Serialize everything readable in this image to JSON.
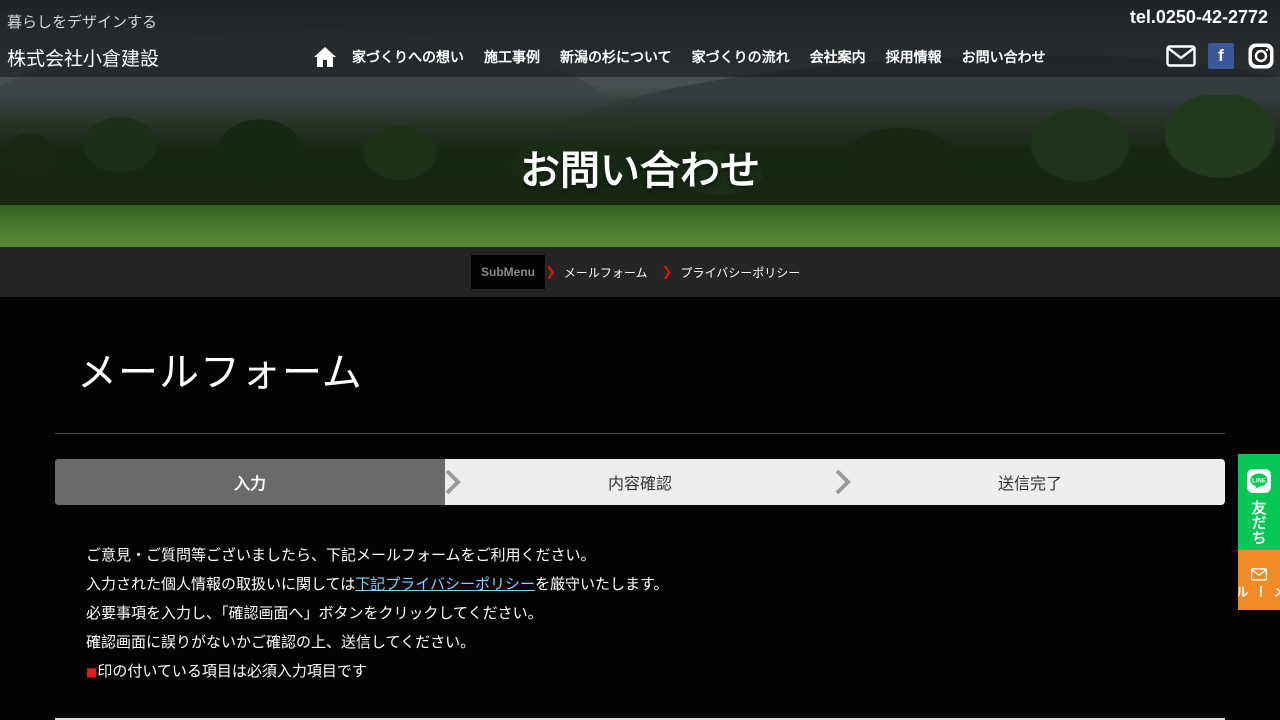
{
  "header": {
    "tagline": "暮らしをデザインする",
    "company": "株式会社小倉建設",
    "tel": "tel.0250-42-2772"
  },
  "nav": {
    "home_icon": "home-icon",
    "items": [
      {
        "label": "家づくりへの想い"
      },
      {
        "label": "施工事例"
      },
      {
        "label": "新潟の杉について"
      },
      {
        "label": "家づくりの流れ"
      },
      {
        "label": "会社案内"
      },
      {
        "label": "採用情報"
      },
      {
        "label": "お問い合わせ"
      }
    ]
  },
  "social": {
    "mail_icon": "mail-icon",
    "facebook_letter": "f",
    "instagram_icon": "instagram-icon"
  },
  "hero": {
    "title": "お問い合わせ"
  },
  "submenu": {
    "label": "SubMenu",
    "links": [
      {
        "label": "メールフォーム"
      },
      {
        "label": "プライバシーポリシー"
      }
    ]
  },
  "main": {
    "title": "メールフォーム",
    "steps": [
      {
        "label": "入力",
        "active": true
      },
      {
        "label": "内容確認",
        "active": false
      },
      {
        "label": "送信完了",
        "active": false
      }
    ],
    "intro": {
      "line1": "ご意見・ご質問等ございましたら、下記メールフォームをご利用ください。",
      "line2_pre": "入力された個人情報の取扱いに関しては",
      "line2_link": "下記プライバシーポリシー",
      "line2_post": "を厳守いたします。",
      "line3": "必要事項を入力し、「確認画面へ」ボタンをクリックしてください。",
      "line4": "確認画面に誤りがないかご確認の上、送信してください。",
      "required_mark": "■",
      "line5": "印の付いている項目は必須入力項目です"
    }
  },
  "side": {
    "line_text": "友だち",
    "mail_text": "メール"
  },
  "colors": {
    "accent_red": "#d01616",
    "link_blue": "#7fd3ff",
    "line_green": "#06c755",
    "mail_orange": "#f08a24",
    "facebook_blue": "#3b5998"
  }
}
